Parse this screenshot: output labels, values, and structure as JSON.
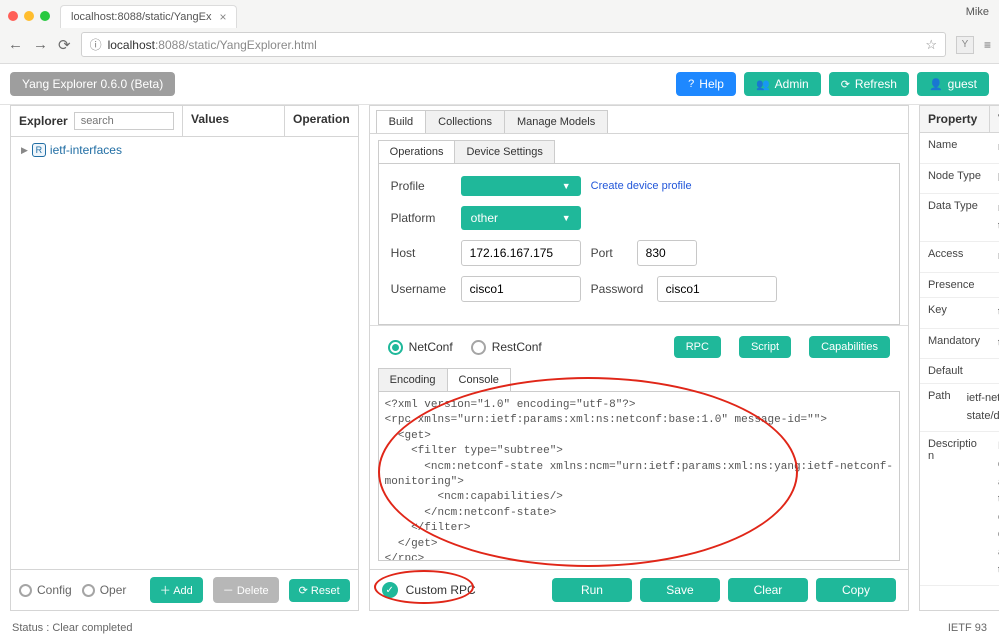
{
  "browser": {
    "tab_title": "localhost:8088/static/YangEx",
    "user": "Mike",
    "url_host": "localhost",
    "url_rest": ":8088/static/YangExplorer.html",
    "provider_letter": "Y"
  },
  "appbar": {
    "title": "Yang Explorer 0.6.0 (Beta)",
    "help": "Help",
    "admin": "Admin",
    "refresh": "Refresh",
    "guest": "guest"
  },
  "left": {
    "explorer": "Explorer",
    "values": "Values",
    "operation": "Operation",
    "search_placeholder": "search",
    "tree_item": "ietf-interfaces",
    "config": "Config",
    "oper": "Oper",
    "add": "Add",
    "delete": "Delete",
    "reset": "Reset"
  },
  "center": {
    "tabs_outer": {
      "build": "Build",
      "collections": "Collections",
      "manage": "Manage Models"
    },
    "tabs_inner": {
      "operations": "Operations",
      "settings": "Device Settings"
    },
    "profile_label": "Profile",
    "create_profile": "Create device profile",
    "platform_label": "Platform",
    "platform_value": "other",
    "host_label": "Host",
    "host_value": "172.16.167.175",
    "port_label": "Port",
    "port_value": "830",
    "user_label": "Username",
    "user_value": "cisco1",
    "pass_label": "Password",
    "pass_value": "cisco1",
    "netconf": "NetConf",
    "restconf": "RestConf",
    "rpc": "RPC",
    "script": "Script",
    "caps": "Capabilities",
    "encoding": "Encoding",
    "console": "Console",
    "xml": "<?xml version=\"1.0\" encoding=\"utf-8\"?>\n<rpc xmlns=\"urn:ietf:params:xml:ns:netconf:base:1.0\" message-id=\"\">\n  <get>\n    <filter type=\"subtree\">\n      <ncm:netconf-state xmlns:ncm=\"urn:ietf:params:xml:ns:yang:ietf-netconf-\nmonitoring\">\n        <ncm:capabilities/>\n      </ncm:netconf-state>\n    </filter>\n  </get>\n</rpc>",
    "custom_rpc": "Custom RPC",
    "run": "Run",
    "save": "Save",
    "clear": "Clear",
    "copy": "Copy"
  },
  "props": {
    "header_k": "Property",
    "header_v": "Value",
    "rows": [
      {
        "k": "Name",
        "v": "name"
      },
      {
        "k": "Node Type",
        "v": "leaf"
      },
      {
        "k": "Data Type",
        "v": "netconf-datastore-type"
      },
      {
        "k": "Access",
        "v": "read-only"
      },
      {
        "k": "Presence",
        "v": ""
      },
      {
        "k": "Key",
        "v": "true"
      },
      {
        "k": "Mandatory",
        "v": "true"
      },
      {
        "k": "Default",
        "v": ""
      },
      {
        "k": "Path",
        "v": "ietf-netconf-monitoring/netconf-state/datastores/datastore/name"
      },
      {
        "k": "Description",
        "v": "Name of the datastore associated with this list entry.Name of the datastore associated with this list entry.None"
      }
    ]
  },
  "status": {
    "text": "Status : Clear completed",
    "ietf": "IETF 93"
  }
}
